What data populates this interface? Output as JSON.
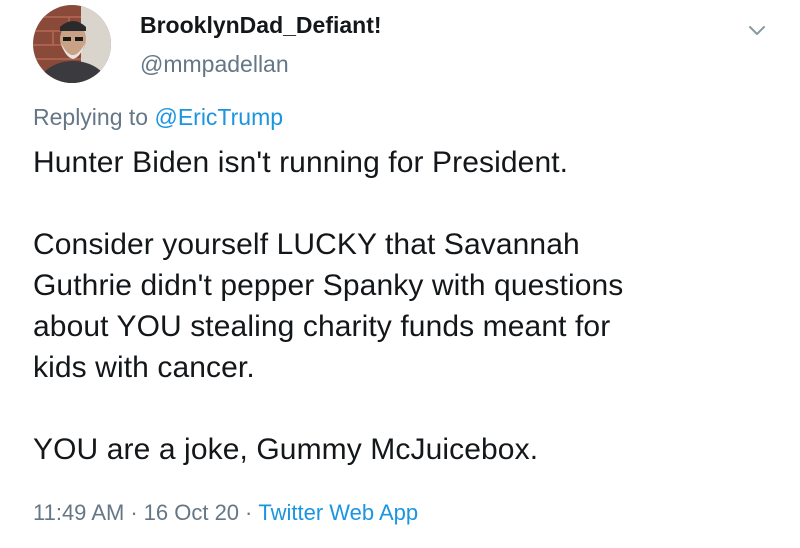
{
  "user": {
    "display_name": "BrooklynDad_Defiant!",
    "username": "@mmpadellan"
  },
  "reply": {
    "prefix": "Replying to",
    "mention": "@EricTrump"
  },
  "tweet": {
    "text": "Hunter Biden isn't running for President.\n\nConsider yourself LUCKY that Savannah\nGuthrie didn't pepper Spanky with questions\nabout YOU stealing charity funds meant for\nkids with cancer.\n\nYOU are a joke, Gummy McJuicebox."
  },
  "meta": {
    "time": "11:49 AM",
    "separator": "·",
    "date": "16 Oct 20",
    "source": "Twitter Web App"
  },
  "icons": {
    "menu": "chevron-down-icon"
  },
  "colors": {
    "link": "#1b95e0",
    "secondary_text": "#657786",
    "primary_text": "#14171a"
  }
}
